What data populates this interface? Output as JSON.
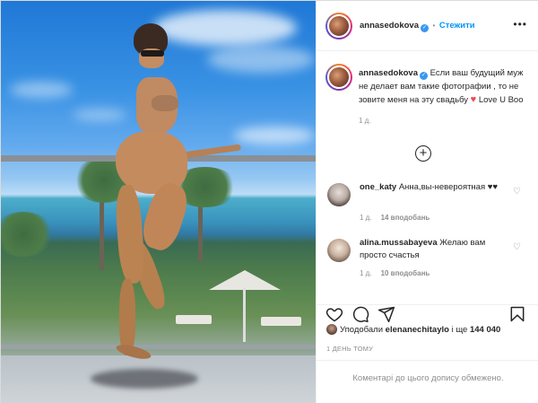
{
  "post": {
    "author": "annasedokova",
    "follow_label": "Стежити",
    "verified_mark": "✓",
    "more_label": "•••"
  },
  "caption": {
    "author": "annasedokova",
    "text": "Если ваш будущий муж не делает вам такие фотографии , то не зовите меня на эту свадьбу",
    "heart": "♥",
    "text_after": "Love U Boo",
    "age": "1 д."
  },
  "load_more": "+",
  "comments": [
    {
      "author": "one_katy",
      "text": "Анна,вы-невероятная ♥♥",
      "age": "1 д.",
      "likes": "14 вподобань"
    },
    {
      "author": "alina.mussabayeva",
      "text": "Желаю вам просто счастья",
      "age": "1 д.",
      "likes": "10 вподобань"
    }
  ],
  "likes_line": {
    "prefix": "Уподобали ",
    "user": "elenanechitaylo",
    "suffix": " і ще ",
    "count": "144 040"
  },
  "timestamp": "1 ДЕНЬ ТОМУ",
  "footer_message": "Коментарі до цього допису обмежено.",
  "icons": {
    "like": "heart-outline-icon",
    "comment": "comment-bubble-icon",
    "share": "paper-plane-icon",
    "save": "bookmark-icon"
  }
}
